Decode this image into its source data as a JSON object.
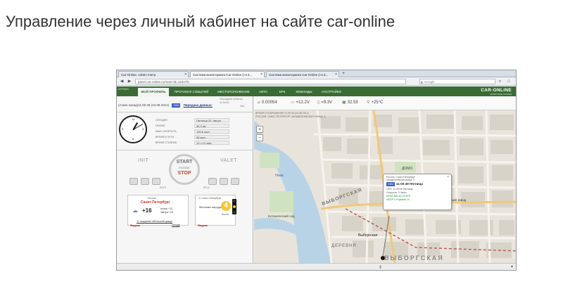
{
  "page": {
    "heading": "Управление через личный кабинет на сайте car-online"
  },
  "browser": {
    "tabs": [
      {
        "label": "Car-Online. Admin menu"
      },
      {
        "label": "Система мониторинга Car-Online (i-3.3...",
        "active": true
      },
      {
        "label": "Система мониторинга Car-Online (i-3.3..."
      }
    ],
    "new_tab": "+",
    "url": "panel.car-online.ru/main?id=11937fe",
    "search_placeholder": "Google"
  },
  "app": {
    "user": "ЮРЕВИЧ",
    "tabs": [
      "мой профиль",
      "протокол событий",
      "местоположение",
      "авто",
      "брк",
      "команды",
      "настройки"
    ],
    "active_tab_index": 0,
    "logo": "CAR-ONLINE",
    "logo_sub": "MONITORING SYSTEM"
  },
  "left_panel": {
    "last_event_label": "Последнее событие",
    "last_event_time": "11:00:49",
    "timeline_prefix": "(2 мин назад)11:00:49 (24.08.2012)",
    "gsm_label": "GSM",
    "transfer_link": "Передача данных:",
    "refresh_label": "обн.",
    "clock_numbers": [
      "12",
      "3",
      "6",
      "9"
    ],
    "info": [
      {
        "label": "Сегодня",
        "value": "Пятница 24. Август"
      },
      {
        "label": "Пробег",
        "value": "36.3 км"
      },
      {
        "label": "Макс.скорость",
        "value": "130.6 км/ч"
      },
      {
        "label": "Время в пути",
        "value": "56 мин."
      },
      {
        "label": "Время стоянок",
        "value": "10 ч.12 мин."
      }
    ],
    "engine": {
      "init": "INIT",
      "valet": "VALET",
      "start": "START",
      "engine": "ENGINE",
      "stop": "STOP",
      "relay_left": "RELE",
      "relay_right": "RELE"
    },
    "weather": {
      "region": "Россия",
      "city": "Санкт-Петербург",
      "temp": "+16",
      "night": "ночью +13",
      "tomorrow": "завтра +18",
      "link": "Ⓐ ожидание небольшой дождь",
      "yandex": "Яндекс",
      "weather_link": "Погода"
    },
    "traffic": {
      "region": "Ⓐ Санкт-Петербург",
      "label": "Местами затруднения",
      "score": "4",
      "ball": "балла",
      "yandex": "Яндекс"
    }
  },
  "map": {
    "status": [
      {
        "icon": "signal-icon",
        "value": "0.00054"
      },
      {
        "icon": "battery-icon",
        "value": "=12.2V"
      },
      {
        "icon": "backup-battery-icon",
        "value": "=9.3V"
      },
      {
        "icon": "fuel-icon",
        "value": "32.59"
      },
      {
        "icon": "thermometer-icon",
        "value": "+25°C"
      }
    ],
    "time_caption": "Время отображения 11:00:49 (24.08.2012)",
    "address_caption": "Россия, Санкт-Петербург, Менделеевская улица, 3",
    "popup": {
      "line1": "Россия, Санкт-Петербург",
      "line2": "Менделеевская улица, 3",
      "time": "11:00:49 Пятница",
      "gsm": "GSM",
      "gps": "GPS: 11:00:49 Пятница",
      "speed": "Скорость: 0.0км/ч",
      "coords": "59°53.46N 30°22.87E",
      "hdop": "HDOP 0.9 sputnik 10"
    },
    "labels": [
      {
        "text": "ВЫБОРГСКАЯ",
        "type": "district"
      },
      {
        "text": "ВЫБОРГСКАЯ",
        "type": "district"
      },
      {
        "text": "Выборгская",
        "type": "metro"
      },
      {
        "text": "ДЕРЕВНЯ",
        "type": "district"
      },
      {
        "text": "Механический завод",
        "type": "poi"
      },
      {
        "text": "Ботанический сад",
        "type": "poi"
      },
      {
        "text": "Нева",
        "type": "water"
      },
      {
        "text": "ДОМО",
        "type": "poi"
      }
    ]
  },
  "bottom": {
    "scroll_glyph": "⇕"
  }
}
